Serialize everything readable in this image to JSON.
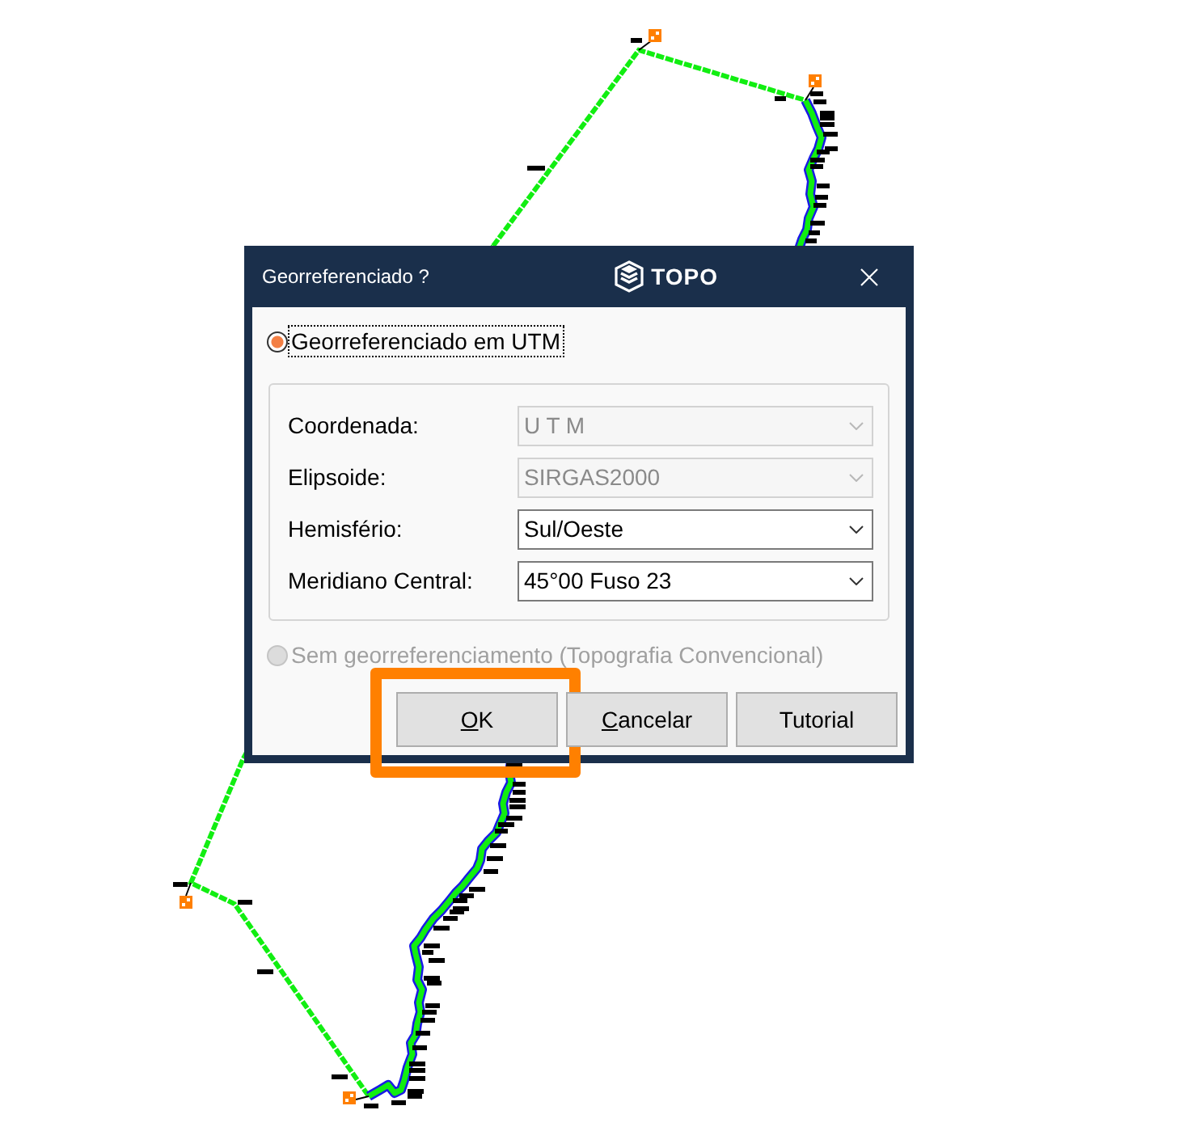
{
  "dialog": {
    "title": "Georreferenciado ?",
    "logo_text": "TOPO",
    "options": [
      {
        "label": "Georreferenciado em UTM",
        "selected": true,
        "disabled": false,
        "focused": true,
        "fields": [
          {
            "label": "Coordenada:",
            "value": "U T M",
            "disabled": true
          },
          {
            "label": "Elipsoide:",
            "value": "SIRGAS2000",
            "disabled": true
          },
          {
            "label": "Hemisfério:",
            "value": "Sul/Oeste",
            "disabled": false
          },
          {
            "label": "Meridiano Central:",
            "value": "45°00 Fuso 23",
            "disabled": false
          }
        ]
      },
      {
        "label": "Sem georreferenciamento (Topografia Convencional)",
        "selected": false,
        "disabled": true,
        "focused": false
      }
    ],
    "buttons": [
      {
        "label": "OK",
        "access_key": true,
        "highlighted": true
      },
      {
        "label": "Cancelar",
        "access_key": true,
        "highlighted": false
      },
      {
        "label": "Tutorial",
        "access_key": false,
        "highlighted": false
      }
    ]
  }
}
